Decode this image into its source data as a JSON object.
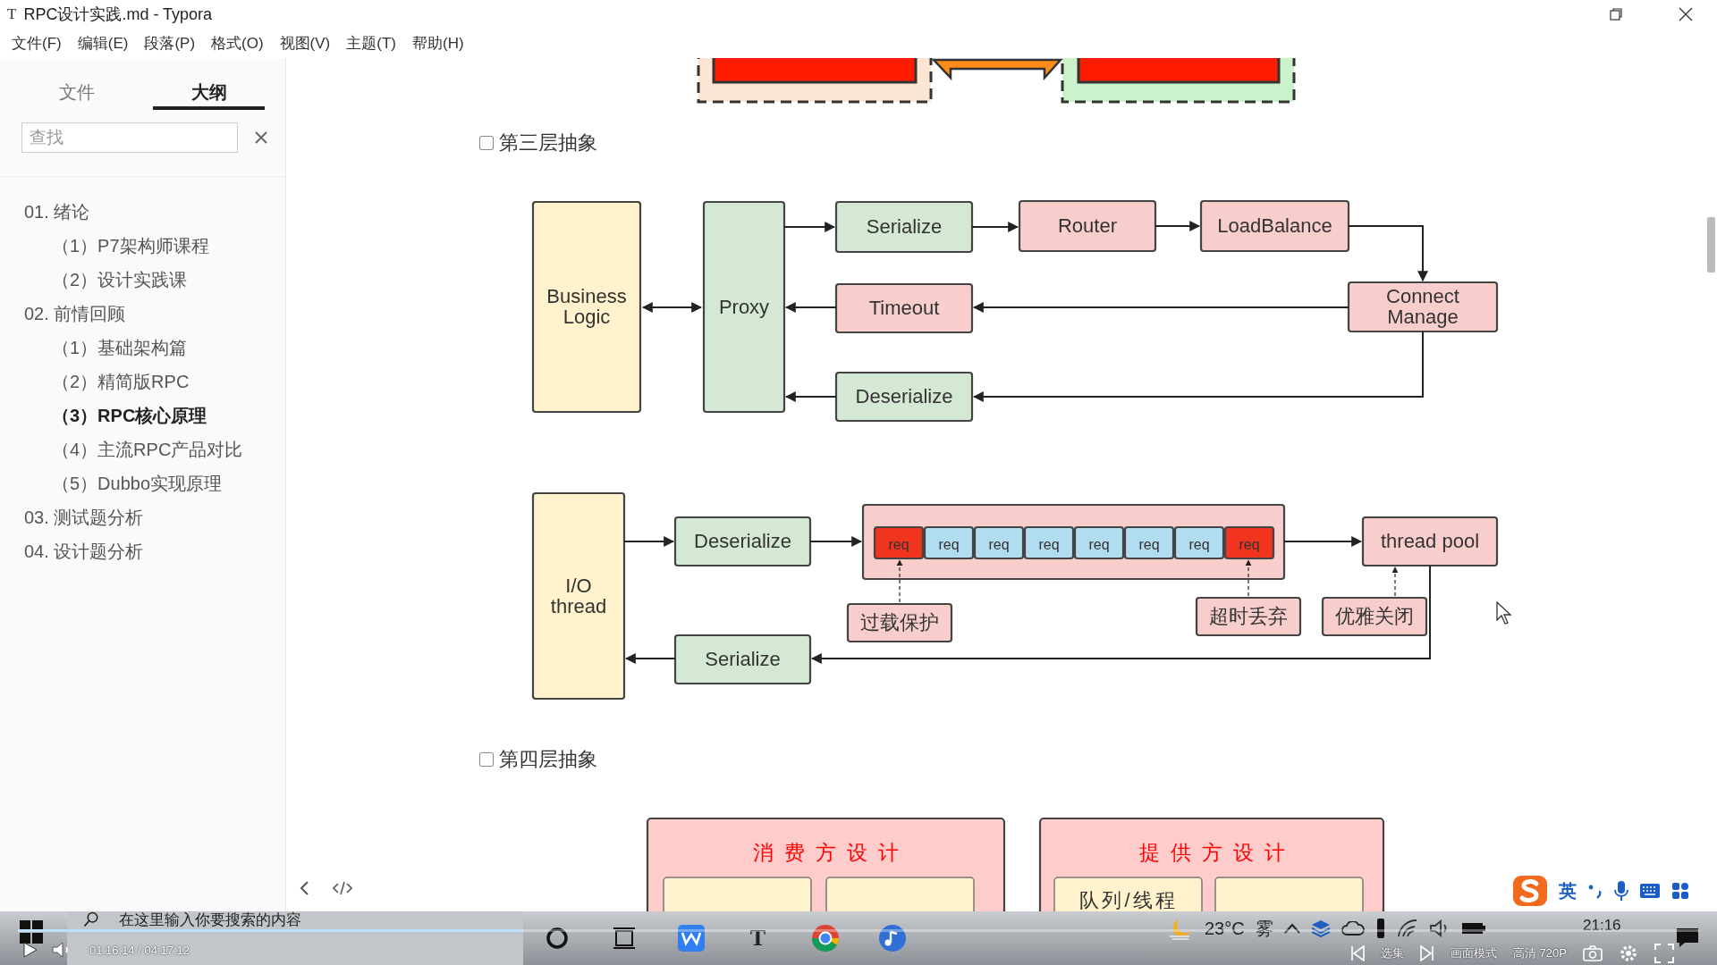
{
  "window": {
    "app_icon": "T",
    "title": "RPC设计实践.md - Typora"
  },
  "menu": [
    "文件(F)",
    "编辑(E)",
    "段落(P)",
    "格式(O)",
    "视图(V)",
    "主题(T)",
    "帮助(H)"
  ],
  "sidebar": {
    "tabs": [
      {
        "label": "文件",
        "selected": false
      },
      {
        "label": "大纲",
        "selected": true
      }
    ],
    "search": {
      "placeholder": "查找"
    },
    "outline": [
      {
        "label": "01. 绪论",
        "selected": false,
        "children": [
          {
            "label": "（1）P7架构师课程",
            "selected": false
          },
          {
            "label": "（2）设计实践课",
            "selected": false
          }
        ]
      },
      {
        "label": "02. 前情回顾",
        "selected": false,
        "children": [
          {
            "label": "（1）基础架构篇",
            "selected": false
          },
          {
            "label": "（2）精简版RPC",
            "selected": false
          },
          {
            "label": "（3）RPC核心原理",
            "selected": true
          },
          {
            "label": "（4）主流RPC产品对比",
            "selected": false
          },
          {
            "label": "（5）Dubbo实现原理",
            "selected": false
          }
        ]
      },
      {
        "label": "03. 测试题分析",
        "selected": false
      },
      {
        "label": "04. 设计题分析",
        "selected": false
      }
    ]
  },
  "sections": [
    {
      "heading": "第三层抽象",
      "checked": false,
      "nodes": [
        {
          "label": "Business Logic",
          "color": "#fff2cc"
        },
        {
          "label": "Proxy",
          "color": "#d5e8d4"
        },
        {
          "label": "Serialize",
          "color": "#d5e8d4"
        },
        {
          "label": "Router",
          "color": "#f8cecc"
        },
        {
          "label": "LoadBalance",
          "color": "#f8cecc"
        },
        {
          "label": "Timeout",
          "color": "#f8cecc"
        },
        {
          "label": "Connect Manage",
          "color": "#f8cecc"
        },
        {
          "label": "Deserialize",
          "color": "#d5e8d4"
        }
      ],
      "nodes_2": [
        {
          "label": "I/O thread",
          "color": "#fff2cc"
        },
        {
          "label": "Deserialize",
          "color": "#d5e8d4"
        },
        {
          "label": "thread pool",
          "color": "#f8cecc"
        },
        {
          "label": "Serialize",
          "color": "#d5e8d4"
        },
        {
          "label": "过载保护",
          "color": "#f8cecc"
        },
        {
          "label": "超时丢弃",
          "color": "#f8cecc"
        },
        {
          "label": "优雅关闭",
          "color": "#f8cecc"
        }
      ],
      "queue": [
        {
          "label": "req",
          "color": "#f0341e"
        },
        {
          "label": "req",
          "color": "#b1ddf0"
        },
        {
          "label": "req",
          "color": "#b1ddf0"
        },
        {
          "label": "req",
          "color": "#b1ddf0"
        },
        {
          "label": "req",
          "color": "#b1ddf0"
        },
        {
          "label": "req",
          "color": "#b1ddf0"
        },
        {
          "label": "req",
          "color": "#b1ddf0"
        },
        {
          "label": "req",
          "color": "#f0341e"
        }
      ]
    },
    {
      "heading": "第四层抽象",
      "checked": false,
      "cards": [
        {
          "title": "消费方设计"
        },
        {
          "title": "提供方设计",
          "items": [
            "队列/线程"
          ]
        }
      ]
    }
  ],
  "ime": {
    "mode": "英"
  },
  "taskbar": {
    "search": {
      "placeholder": "在这里输入你要搜索的内容"
    },
    "app_letter": "T",
    "temperature": "23°C",
    "weather": "雾",
    "clock": "21:16"
  },
  "video_player": {
    "time": "01:16:14 / 04:17:12",
    "level": 0.3,
    "episodes": "选集",
    "display_mode": "画面模式",
    "quality": "高清 720P"
  }
}
